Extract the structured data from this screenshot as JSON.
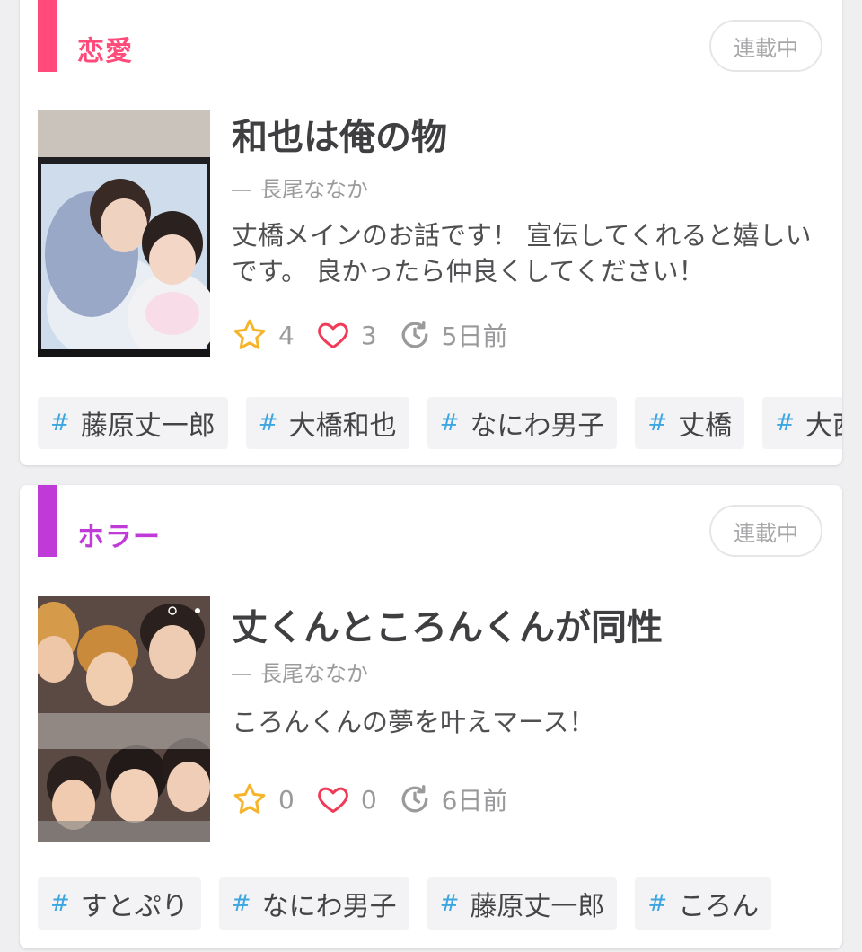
{
  "colors": {
    "romance": "#ff4a7a",
    "horror": "#c03ad8",
    "hashtag": "#3ca6e0",
    "star": "#f6b42a",
    "heart": "#ef3b57"
  },
  "stories": [
    {
      "genre": "恋愛",
      "status": "連載中",
      "title": "和也は俺の物",
      "author": "長尾ななか",
      "description": "丈橋メインのお話です！ 宣伝してくれると嬉しいです。 良かったら仲良くしてください！",
      "stars": "4",
      "likes": "3",
      "updated": "5日前",
      "tags": [
        "藤原丈一郎",
        "大橋和也",
        "なにわ男子",
        "丈橋",
        "大西"
      ]
    },
    {
      "genre": "ホラー",
      "status": "連載中",
      "title": "丈くんところんくんが同性",
      "author": "長尾ななか",
      "description": "ころんくんの夢を叶えマース！",
      "stars": "0",
      "likes": "0",
      "updated": "6日前",
      "tags": [
        "すとぷり",
        "なにわ男子",
        "藤原丈一郎",
        "ころん"
      ]
    }
  ]
}
